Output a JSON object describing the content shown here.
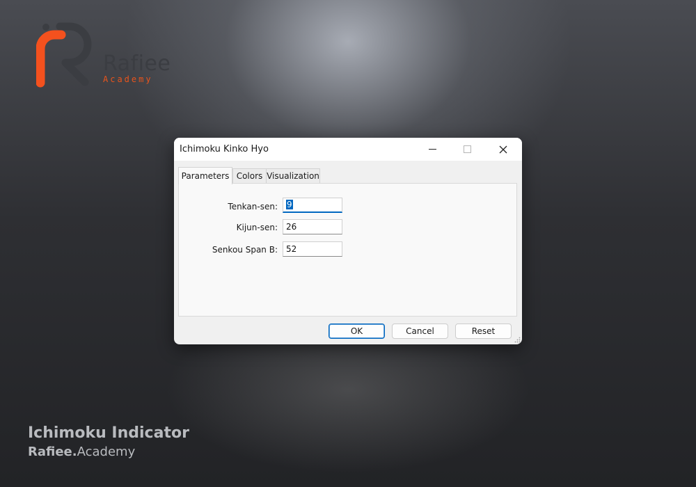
{
  "branding": {
    "logo_word": "Rafiee",
    "logo_sub": "Academy",
    "accent_color": "#e8541c"
  },
  "caption": {
    "title": "Ichimoku Indicator",
    "brand_bold": "Rafiee.",
    "brand_light": "Academy"
  },
  "dialog": {
    "title": "Ichimoku Kinko Hyo",
    "tabs": [
      {
        "label": "Parameters",
        "active": true
      },
      {
        "label": "Colors",
        "active": false
      },
      {
        "label": "Visualization",
        "active": false
      }
    ],
    "fields": [
      {
        "label": "Tenkan-sen:",
        "value": "9",
        "focused": true
      },
      {
        "label": "Kijun-sen:",
        "value": "26"
      },
      {
        "label": "Senkou Span B:",
        "value": "52"
      }
    ],
    "buttons": {
      "ok": "OK",
      "cancel": "Cancel",
      "reset": "Reset"
    },
    "icons": {
      "minimize": "minimize-icon",
      "maximize": "maximize-icon",
      "close": "close-icon"
    },
    "focus_color": "#0067c0"
  }
}
